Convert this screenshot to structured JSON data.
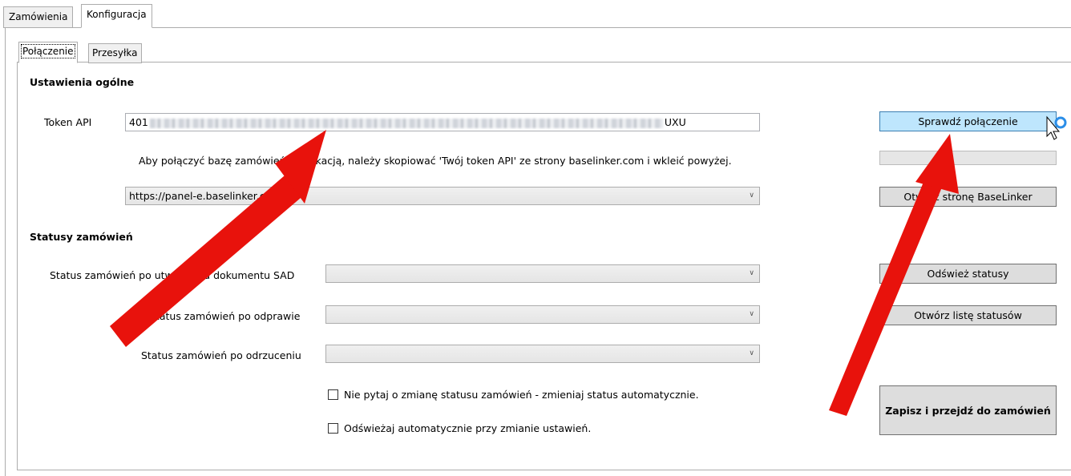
{
  "outer_tabs": [
    {
      "label": "Zamówienia",
      "active": false
    },
    {
      "label": "Konfiguracja",
      "active": true
    }
  ],
  "inner_tabs": [
    {
      "label": "Połączenie",
      "active": true
    },
    {
      "label": "Przesyłka",
      "active": false
    }
  ],
  "general": {
    "title": "Ustawienia ogólne",
    "token_label": "Token API",
    "token_prefix": "401",
    "token_suffix": "UXU",
    "hint": "Aby połączyć bazę zamówień z aplikacją, należy skopiować 'Twój token API' ze strony baselinker.com i wkleić powyżej.",
    "url_value": "https://panel-e.baselinker.com",
    "check_button": "Sprawdź połączenie",
    "open_button": "Otwórz stronę BaseLinker"
  },
  "statuses": {
    "title": "Statusy zamówień",
    "sad_label": "Status zamówień po utworzeniu dokumentu SAD",
    "clearance_label": "Status zamówień po odprawie",
    "rejection_label": "Status zamówień po odrzuceniu",
    "refresh_button": "Odśwież statusy",
    "open_list_button": "Otwórz listę statusów",
    "auto_status_check": "Nie pytaj o zmianę statusu zamówień - zmieniaj status automatycznie.",
    "auto_refresh_check": "Odświeżaj automatycznie przy zmianie ustawień.",
    "save_button": "Zapisz i przejdź do zamówień"
  },
  "colors": {
    "annotation_arrow": "#e8120c",
    "hover_button": "#bee6fd"
  },
  "icons": {
    "cursor": "arrow-cursor-icon",
    "busy": "busy-ring-icon"
  }
}
